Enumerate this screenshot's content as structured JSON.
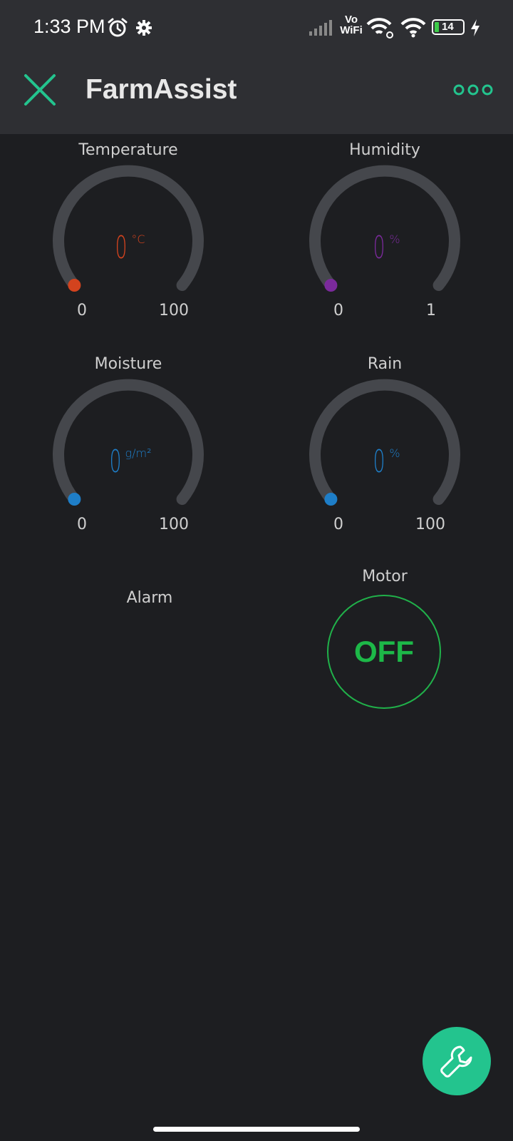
{
  "status_bar": {
    "time": "1:33 PM",
    "battery": "14",
    "network_label_top": "Vo",
    "network_label_bottom": "WiFi",
    "icons": [
      "alarm-icon",
      "settings-icon",
      "signal-icon",
      "wifi-link-icon",
      "wifi-icon",
      "battery-icon",
      "charging-icon"
    ]
  },
  "app_bar": {
    "title": "FarmAssist",
    "close_icon": "close-icon",
    "more_icon": "more-icon",
    "accent": "#23c48e"
  },
  "gauges": [
    {
      "label": "Temperature",
      "value": "0",
      "unit": "°C",
      "min": "0",
      "max": "100",
      "color": "#d3431e"
    },
    {
      "label": "Humidity",
      "value": "0",
      "unit": "%",
      "min": "0",
      "max": "1",
      "color": "#7b2a9c"
    },
    {
      "label": "Moisture",
      "value": "0",
      "unit": "g/m²",
      "min": "0",
      "max": "100",
      "color": "#1e7ec8"
    },
    {
      "label": "Rain",
      "value": "0",
      "unit": "%",
      "min": "0",
      "max": "100",
      "color": "#1e7ec8"
    }
  ],
  "alarm": {
    "label": "Alarm"
  },
  "motor": {
    "label": "Motor",
    "state": "OFF",
    "color": "#1db848"
  },
  "fab": {
    "icon": "wrench-icon"
  }
}
